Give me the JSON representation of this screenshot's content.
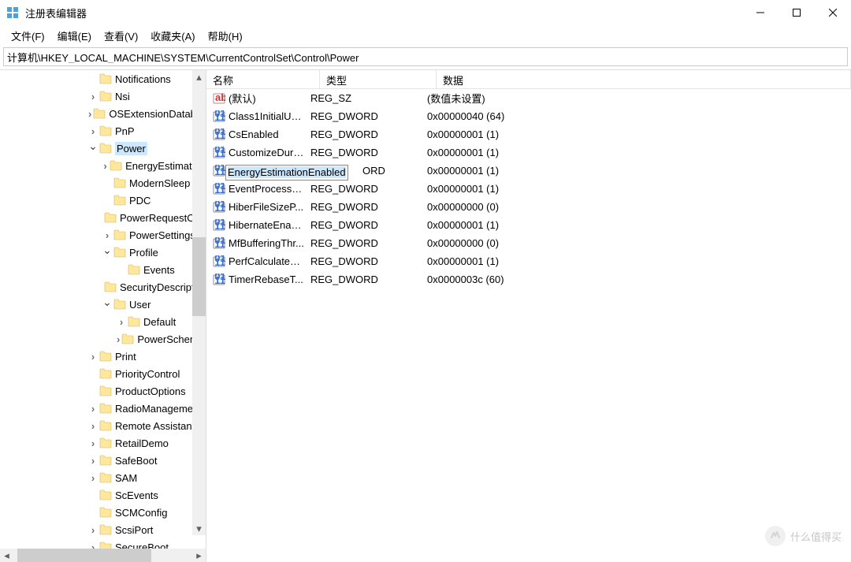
{
  "window": {
    "title": "注册表编辑器"
  },
  "menu": {
    "file": "文件(F)",
    "edit": "编辑(E)",
    "view": "查看(V)",
    "fav": "收藏夹(A)",
    "help": "帮助(H)"
  },
  "address": {
    "path": "计算机\\HKEY_LOCAL_MACHINE\\SYSTEM\\CurrentControlSet\\Control\\Power"
  },
  "tree": [
    {
      "depth": 0,
      "expander": "",
      "label": "Notifications"
    },
    {
      "depth": 0,
      "expander": ">",
      "label": "Nsi"
    },
    {
      "depth": 0,
      "expander": ">",
      "label": "OSExtensionDatabase"
    },
    {
      "depth": 0,
      "expander": ">",
      "label": "PnP"
    },
    {
      "depth": 0,
      "expander": "v",
      "label": "Power",
      "selected": true
    },
    {
      "depth": 1,
      "expander": ">",
      "label": "EnergyEstimation"
    },
    {
      "depth": 1,
      "expander": "",
      "label": "ModernSleep"
    },
    {
      "depth": 1,
      "expander": "",
      "label": "PDC"
    },
    {
      "depth": 1,
      "expander": "",
      "label": "PowerRequestOverride"
    },
    {
      "depth": 1,
      "expander": ">",
      "label": "PowerSettings"
    },
    {
      "depth": 1,
      "expander": "v",
      "label": "Profile"
    },
    {
      "depth": 2,
      "expander": "",
      "label": "Events"
    },
    {
      "depth": 1,
      "expander": "",
      "label": "SecurityDescriptors"
    },
    {
      "depth": 1,
      "expander": "v",
      "label": "User"
    },
    {
      "depth": 2,
      "expander": ">",
      "label": "Default"
    },
    {
      "depth": 2,
      "expander": ">",
      "label": "PowerSchemes"
    },
    {
      "depth": 0,
      "expander": ">",
      "label": "Print"
    },
    {
      "depth": 0,
      "expander": "",
      "label": "PriorityControl"
    },
    {
      "depth": 0,
      "expander": "",
      "label": "ProductOptions"
    },
    {
      "depth": 0,
      "expander": ">",
      "label": "RadioManagement"
    },
    {
      "depth": 0,
      "expander": ">",
      "label": "Remote Assistance"
    },
    {
      "depth": 0,
      "expander": ">",
      "label": "RetailDemo"
    },
    {
      "depth": 0,
      "expander": ">",
      "label": "SafeBoot"
    },
    {
      "depth": 0,
      "expander": ">",
      "label": "SAM"
    },
    {
      "depth": 0,
      "expander": "",
      "label": "ScEvents"
    },
    {
      "depth": 0,
      "expander": "",
      "label": "SCMConfig"
    },
    {
      "depth": 0,
      "expander": ">",
      "label": "ScsiPort"
    },
    {
      "depth": 0,
      "expander": ">",
      "label": "SecureBoot"
    }
  ],
  "list": {
    "columns": {
      "name": "名称",
      "type": "类型",
      "data": "数据"
    },
    "rows": [
      {
        "icon": "sz",
        "name": "(默认)",
        "type": "REG_SZ",
        "data": "(数值未设置)"
      },
      {
        "icon": "dw",
        "name": "Class1InitialUn...",
        "type": "REG_DWORD",
        "data": "0x00000040 (64)"
      },
      {
        "icon": "dw",
        "name": "CsEnabled",
        "type": "REG_DWORD",
        "data": "0x00000001 (1)"
      },
      {
        "icon": "dw",
        "name": "CustomizeDuri...",
        "type": "REG_DWORD",
        "data": "0x00000001 (1)"
      },
      {
        "icon": "dw",
        "name": "EnergyEstimationEnabled",
        "type": "ORD",
        "type_suffix_only": true,
        "data": "0x00000001 (1)",
        "editing": true
      },
      {
        "icon": "dw",
        "name": "EventProcesso...",
        "type": "REG_DWORD",
        "data": "0x00000001 (1)"
      },
      {
        "icon": "dw",
        "name": "HiberFileSizeP...",
        "type": "REG_DWORD",
        "data": "0x00000000 (0)"
      },
      {
        "icon": "dw",
        "name": "HibernateEnab...",
        "type": "REG_DWORD",
        "data": "0x00000001 (1)"
      },
      {
        "icon": "dw",
        "name": "MfBufferingThr...",
        "type": "REG_DWORD",
        "data": "0x00000000 (0)"
      },
      {
        "icon": "dw",
        "name": "PerfCalculateA...",
        "type": "REG_DWORD",
        "data": "0x00000001 (1)"
      },
      {
        "icon": "dw",
        "name": "TimerRebaseT...",
        "type": "REG_DWORD",
        "data": "0x0000003c (60)"
      }
    ]
  },
  "watermark": {
    "text": "什么值得买"
  }
}
